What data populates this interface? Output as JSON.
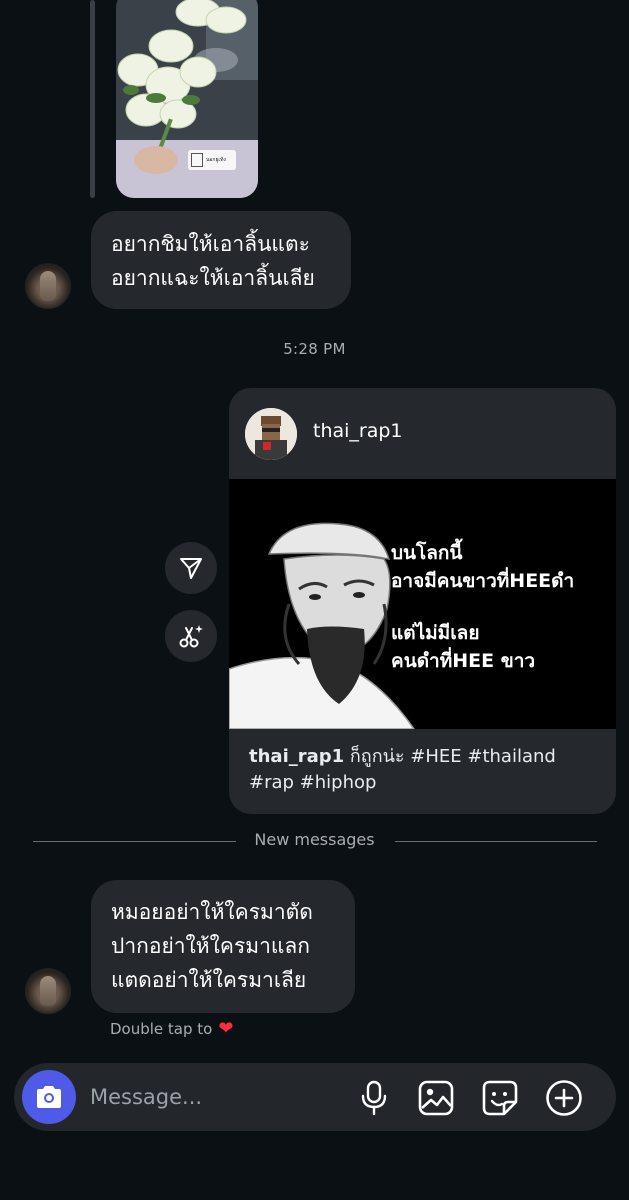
{
  "story_reply": {
    "watermark_text": "นอกยูเท้ง"
  },
  "messages": [
    {
      "lines": [
        "อยากชิมให้เอาลิ้นแตะ",
        "อยากแฉะให้เอาลิ้นเลีย"
      ]
    }
  ],
  "timestamp": "5:28 PM",
  "shared_post": {
    "username": "thai_rap1",
    "meme_lines_top": [
      "บนโลกนี้",
      "อาจมีคนขาวที่HEEดำ"
    ],
    "meme_lines_bottom": [
      "แต่ไม่มีเลย",
      "คนดำที่HEE ขาว"
    ],
    "caption_user": "thai_rap1",
    "caption_text": "ก็ถูกน่ะ #HEE #thailand #rap #hiphop"
  },
  "new_messages_label": "New messages",
  "latest_message": {
    "lines": [
      "หมอยอย่าให้ใครมาตัด",
      "ปากอย่าให้ใครมาแลก",
      "แตดอย่าให้ใครมาเลีย"
    ]
  },
  "double_tap": {
    "label": "Double tap to",
    "emoji": "❤"
  },
  "composer": {
    "placeholder": "Message..."
  },
  "colors": {
    "background": "#0b1014",
    "bubble": "#25292e",
    "camera_button": "#4f5be8",
    "heart": "#ff2d3d"
  },
  "icons": [
    "camera-icon",
    "microphone-icon",
    "gallery-icon",
    "sticker-icon",
    "plus-icon",
    "send-icon",
    "ai-sparkle-icon"
  ]
}
